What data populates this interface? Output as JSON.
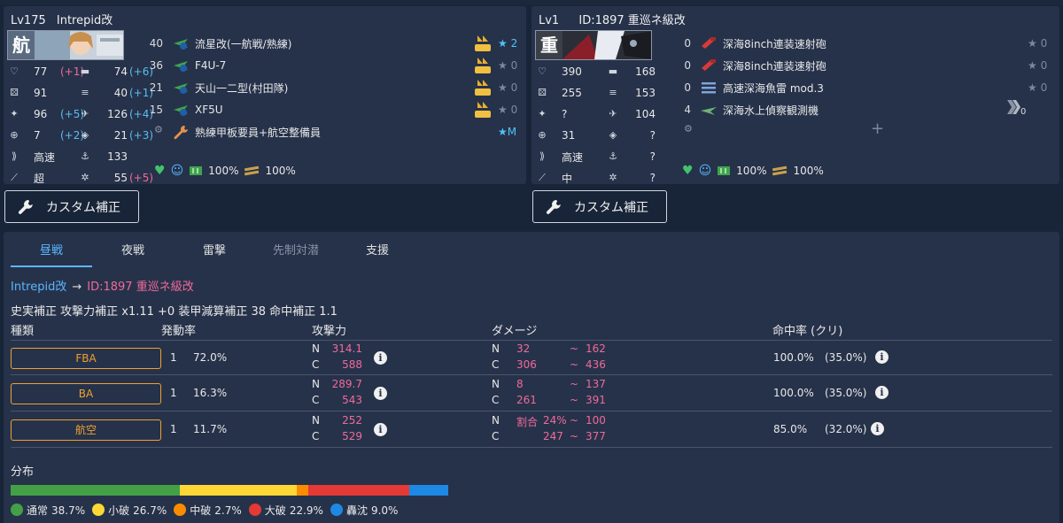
{
  "left_ship": {
    "level": "Lv175",
    "name": "Intrepid改",
    "banner_kanji": "航",
    "stats": [
      {
        "icon": "hp-icon",
        "value": "77",
        "bonus": "(+1)",
        "bonus_color": "neg"
      },
      {
        "icon": "armor-icon",
        "value": "74",
        "bonus": "(+6)",
        "bonus_color": "pos"
      },
      {
        "icon": "luck-icon",
        "value": "91",
        "bonus": "",
        "bonus_color": ""
      },
      {
        "icon": "torpedo-icon",
        "value": "40",
        "bonus": "(+1)",
        "bonus_color": "pos"
      },
      {
        "icon": "firepower-icon",
        "value": "96",
        "bonus": "(+5)",
        "bonus_color": "pos"
      },
      {
        "icon": "aa-icon",
        "value": "126",
        "bonus": "(+4)",
        "bonus_color": "pos"
      },
      {
        "icon": "accuracy-icon",
        "value": "7",
        "bonus": "(+2)",
        "bonus_color": "pos"
      },
      {
        "icon": "evasion-icon",
        "value": "21",
        "bonus": "(+3)",
        "bonus_color": "pos"
      },
      {
        "icon": "speed-icon",
        "value": "高速",
        "bonus": "",
        "bonus_color": ""
      },
      {
        "icon": "asw-icon",
        "value": "133",
        "bonus": "",
        "bonus_color": ""
      },
      {
        "icon": "range-icon",
        "value": "超",
        "bonus": "",
        "bonus_color": ""
      },
      {
        "icon": "los-icon",
        "value": "55",
        "bonus": "(+5)",
        "bonus_color": "neg"
      }
    ],
    "equipment": [
      {
        "slot": "40",
        "name": "流星改(一航戦/熟練)",
        "star": "★ 2",
        "star_on": true,
        "prof": "120"
      },
      {
        "slot": "36",
        "name": "F4U-7",
        "star": "★ 0",
        "star_on": false,
        "prof": "120"
      },
      {
        "slot": "21",
        "name": "天山一二型(村田隊)",
        "star": "★ 0",
        "star_on": false,
        "prof": "120"
      },
      {
        "slot": "15",
        "name": "XF5U",
        "star": "★ 0",
        "star_on": false,
        "prof": "120"
      },
      {
        "slot": "",
        "name": "熟練甲板要員+航空整備員",
        "star": "★M",
        "star_on": true,
        "prof": ""
      }
    ],
    "morale": {
      "fuel": "100%",
      "ammo": "100%"
    }
  },
  "right_ship": {
    "level": "Lv1",
    "name": "ID:1897 重巡ネ級改",
    "banner_kanji": "重",
    "stats": [
      {
        "icon": "hp-icon",
        "value": "390",
        "bonus": "",
        "bonus_color": ""
      },
      {
        "icon": "armor-icon",
        "value": "168",
        "bonus": "",
        "bonus_color": ""
      },
      {
        "icon": "luck-icon",
        "value": "255",
        "bonus": "",
        "bonus_color": ""
      },
      {
        "icon": "torpedo-icon",
        "value": "153",
        "bonus": "",
        "bonus_color": ""
      },
      {
        "icon": "firepower-icon",
        "value": "?",
        "bonus": "",
        "bonus_color": ""
      },
      {
        "icon": "aa-icon",
        "value": "104",
        "bonus": "",
        "bonus_color": ""
      },
      {
        "icon": "accuracy-icon",
        "value": "31",
        "bonus": "",
        "bonus_color": ""
      },
      {
        "icon": "evasion-icon",
        "value": "?",
        "bonus": "",
        "bonus_color": ""
      },
      {
        "icon": "speed-icon",
        "value": "高速",
        "bonus": "",
        "bonus_color": ""
      },
      {
        "icon": "asw-icon",
        "value": "?",
        "bonus": "",
        "bonus_color": ""
      },
      {
        "icon": "range-icon",
        "value": "中",
        "bonus": "",
        "bonus_color": ""
      },
      {
        "icon": "los-icon",
        "value": "?",
        "bonus": "",
        "bonus_color": ""
      }
    ],
    "equipment": [
      {
        "slot": "0",
        "name": "深海8inch連装速射砲",
        "star": "★ 0",
        "star_on": false
      },
      {
        "slot": "0",
        "name": "深海8inch連装速射砲",
        "star": "★ 0",
        "star_on": false
      },
      {
        "slot": "0",
        "name": "高速深海魚雷 mod.3",
        "star": "★ 0",
        "star_on": false
      },
      {
        "slot": "4",
        "name": "深海水上偵察観測機",
        "star": "",
        "star_on": false
      }
    ],
    "prof_value": "0",
    "morale": {
      "fuel": "100%",
      "ammo": "100%"
    }
  },
  "custom_button_label": "カスタム補正",
  "tabs": [
    "昼戦",
    "夜戦",
    "雷撃",
    "先制対潜",
    "支援"
  ],
  "attacker": "Intrepid改",
  "defender": "ID:1897 重巡ネ級改",
  "modifiers": "史実補正 攻撃力補正 x1.11 +0 装甲減算補正 38 命中補正 1.1",
  "headers": {
    "type": "種類",
    "rate": "発動率",
    "power": "攻撃力",
    "damage": "ダメージ",
    "hit": "命中率 (クリ)"
  },
  "attacks": [
    {
      "name": "FBA",
      "count": "1",
      "rate": "72.0%",
      "n_power": "314.1",
      "c_power": "588",
      "n_dmg_min": "32",
      "n_dmg_max": "162",
      "c_dmg_min": "306",
      "c_dmg_max": "436",
      "n_prefix": "",
      "hit": "100.0%",
      "crit": "(35.0%)"
    },
    {
      "name": "BA",
      "count": "1",
      "rate": "16.3%",
      "n_power": "289.7",
      "c_power": "543",
      "n_dmg_min": "8",
      "n_dmg_max": "137",
      "c_dmg_min": "261",
      "c_dmg_max": "391",
      "n_prefix": "",
      "hit": "100.0%",
      "crit": "(35.0%)"
    },
    {
      "name": "航空",
      "count": "1",
      "rate": "11.7%",
      "n_power": "252",
      "c_power": "529",
      "n_dmg_min": "24%",
      "n_dmg_max": "100",
      "c_dmg_min": "247",
      "c_dmg_max": "377",
      "n_prefix": "割合",
      "hit": "85.0%",
      "crit": "(32.0%)"
    }
  ],
  "distribution_label": "分布",
  "distribution": [
    {
      "label": "通常",
      "value": "38.7%",
      "frac": 0.387,
      "color": "#43a047"
    },
    {
      "label": "小破",
      "value": "26.7%",
      "frac": 0.267,
      "color": "#fdd835"
    },
    {
      "label": "中破",
      "value": "2.7%",
      "frac": 0.027,
      "color": "#fb8c00"
    },
    {
      "label": "大破",
      "value": "22.9%",
      "frac": 0.229,
      "color": "#e53935"
    },
    {
      "label": "轟沈",
      "value": "9.0%",
      "frac": 0.09,
      "color": "#1e88e5"
    }
  ],
  "n_label": "N",
  "c_label": "C",
  "tilde": "~"
}
